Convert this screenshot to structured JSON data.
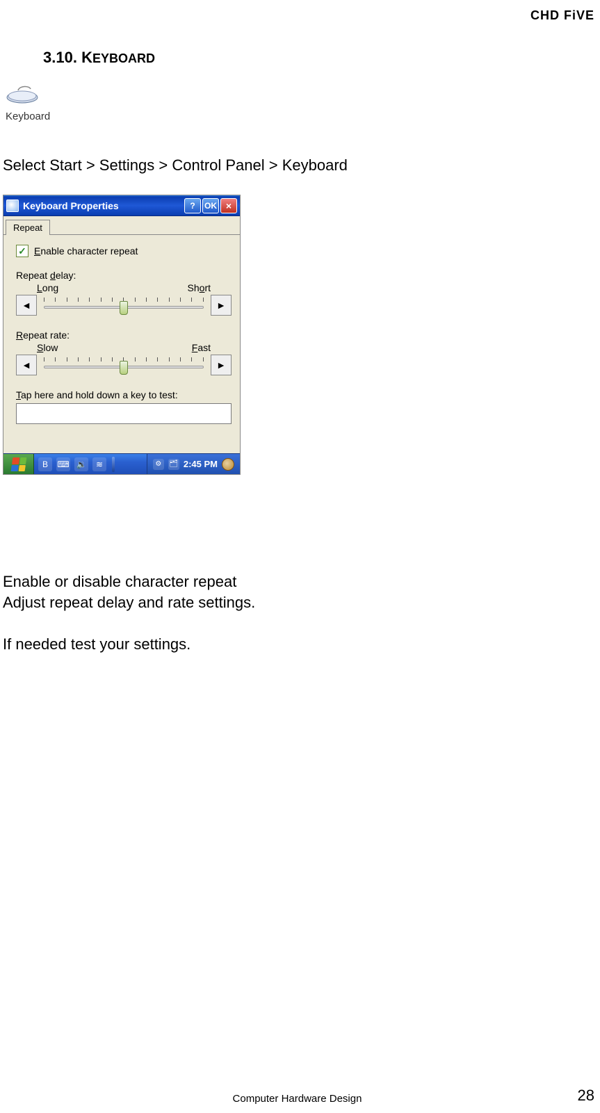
{
  "header": {
    "brand": "CHD FiVE"
  },
  "section": {
    "number": "3.10.",
    "title_prefix": "K",
    "title_rest": "EYBOARD"
  },
  "icon": {
    "label": "Keyboard"
  },
  "breadcrumb": "Select Start > Settings > Control Panel > Keyboard",
  "dialog": {
    "title": "Keyboard Properties",
    "help_label": "?",
    "ok_label": "OK",
    "close_label": "×",
    "tab": "Repeat",
    "checkbox": {
      "checked": true,
      "prefix": "E",
      "rest": "nable character repeat"
    },
    "delay": {
      "title_prefix": "Repeat ",
      "title_u": "d",
      "title_rest": "elay:",
      "left_prefix": "L",
      "left_rest": "ong",
      "right_prefix": "Sh",
      "right_u": "o",
      "right_rest": "rt",
      "left_arrow": "◄",
      "right_arrow": "►"
    },
    "rate": {
      "title_u": "R",
      "title_rest": "epeat rate:",
      "left_u": "S",
      "left_rest": "low",
      "right_u": "F",
      "right_rest": "ast",
      "left_arrow": "◄",
      "right_arrow": "►"
    },
    "test": {
      "label_u": "T",
      "label_rest": "ap here and hold down a key to test:",
      "value": ""
    },
    "taskbar": {
      "bt_icon": "B",
      "kb_icon": "⌨",
      "vol_icon": "🔉",
      "net_icon": "≋",
      "tray1": "⚙",
      "tray2": "🗂",
      "time": "2:45 PM"
    }
  },
  "body": {
    "line1": "Enable or disable character repeat",
    "line2": "Adjust repeat delay and rate settings.",
    "line3": "If needed test your settings."
  },
  "footer": {
    "center": "Computer Hardware Design",
    "page": "28"
  }
}
